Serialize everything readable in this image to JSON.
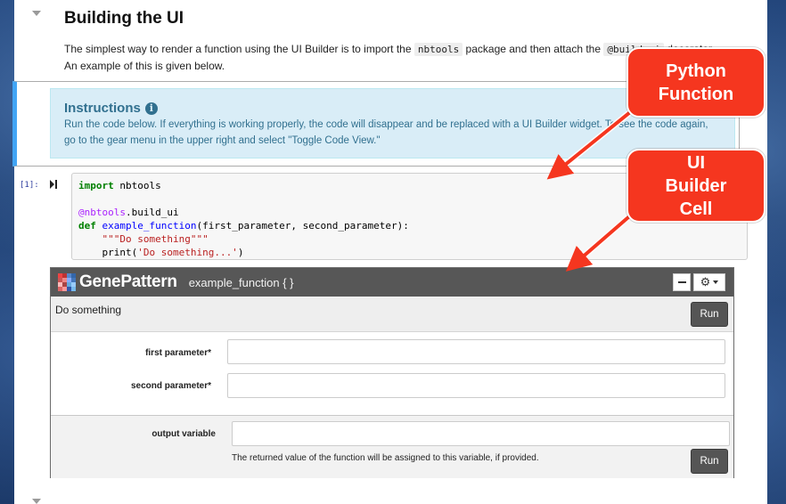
{
  "section": {
    "heading": "Building the UI",
    "para_line1_before": "The simplest way to render a function using the UI Builder is to import the ",
    "para_code1": "nbtools",
    "para_line1_middle": " package and then attach the ",
    "para_code2": "@build_ui",
    "para_line1_after": " decorator.",
    "para_line2": "An example of this is given below."
  },
  "instructions": {
    "title": "Instructions",
    "icon": "info-circle-icon",
    "body": "Run the code below. If everything is working properly, the code will disappear and be replaced with a UI Builder widget. To see the code again, go to the gear menu in the upper right and select \"Toggle Code View.\""
  },
  "code_cell": {
    "prompt": "[1]:",
    "lines": {
      "l1_kw": "import",
      "l1_rest": " nbtools",
      "l3_deco": "@nbtools",
      "l3_rest": ".build_ui",
      "l4_kw": "def",
      "l4_fn": "example_function",
      "l4_rest": "(first_parameter, second_parameter):",
      "l5_str": "\"\"\"Do something\"\"\"",
      "l6_call": "print(",
      "l6_str": "'Do something...'",
      "l6_end": ")"
    }
  },
  "widget": {
    "brand": "GenePattern",
    "function_name": "example_function { }",
    "description": "Do something",
    "run_label": "Run",
    "params": [
      {
        "label": "first parameter*",
        "value": ""
      },
      {
        "label": "second parameter*",
        "value": ""
      }
    ],
    "output": {
      "label": "output variable",
      "value": "",
      "help": "The returned value of the function will be assigned to this variable, if provided."
    },
    "minimize_icon": "minus-icon",
    "gear_icon": "gear-icon"
  },
  "callouts": {
    "python": "Python Function",
    "uibuilder": "UI Builder Cell"
  },
  "colors": {
    "callout": "#f5361f",
    "header": "#575757",
    "selected_border": "#42a5f5",
    "instructions_bg": "#d9edf7"
  }
}
